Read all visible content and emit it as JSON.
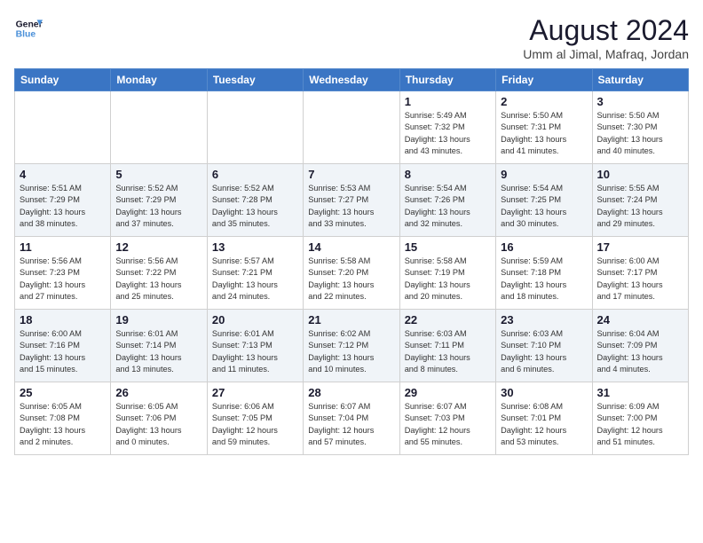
{
  "logo": {
    "line1": "General",
    "line2": "Blue"
  },
  "title": "August 2024",
  "location": "Umm al Jimal, Mafraq, Jordan",
  "weekdays": [
    "Sunday",
    "Monday",
    "Tuesday",
    "Wednesday",
    "Thursday",
    "Friday",
    "Saturday"
  ],
  "weeks": [
    [
      {
        "day": "",
        "info": ""
      },
      {
        "day": "",
        "info": ""
      },
      {
        "day": "",
        "info": ""
      },
      {
        "day": "",
        "info": ""
      },
      {
        "day": "1",
        "info": "Sunrise: 5:49 AM\nSunset: 7:32 PM\nDaylight: 13 hours\nand 43 minutes."
      },
      {
        "day": "2",
        "info": "Sunrise: 5:50 AM\nSunset: 7:31 PM\nDaylight: 13 hours\nand 41 minutes."
      },
      {
        "day": "3",
        "info": "Sunrise: 5:50 AM\nSunset: 7:30 PM\nDaylight: 13 hours\nand 40 minutes."
      }
    ],
    [
      {
        "day": "4",
        "info": "Sunrise: 5:51 AM\nSunset: 7:29 PM\nDaylight: 13 hours\nand 38 minutes."
      },
      {
        "day": "5",
        "info": "Sunrise: 5:52 AM\nSunset: 7:29 PM\nDaylight: 13 hours\nand 37 minutes."
      },
      {
        "day": "6",
        "info": "Sunrise: 5:52 AM\nSunset: 7:28 PM\nDaylight: 13 hours\nand 35 minutes."
      },
      {
        "day": "7",
        "info": "Sunrise: 5:53 AM\nSunset: 7:27 PM\nDaylight: 13 hours\nand 33 minutes."
      },
      {
        "day": "8",
        "info": "Sunrise: 5:54 AM\nSunset: 7:26 PM\nDaylight: 13 hours\nand 32 minutes."
      },
      {
        "day": "9",
        "info": "Sunrise: 5:54 AM\nSunset: 7:25 PM\nDaylight: 13 hours\nand 30 minutes."
      },
      {
        "day": "10",
        "info": "Sunrise: 5:55 AM\nSunset: 7:24 PM\nDaylight: 13 hours\nand 29 minutes."
      }
    ],
    [
      {
        "day": "11",
        "info": "Sunrise: 5:56 AM\nSunset: 7:23 PM\nDaylight: 13 hours\nand 27 minutes."
      },
      {
        "day": "12",
        "info": "Sunrise: 5:56 AM\nSunset: 7:22 PM\nDaylight: 13 hours\nand 25 minutes."
      },
      {
        "day": "13",
        "info": "Sunrise: 5:57 AM\nSunset: 7:21 PM\nDaylight: 13 hours\nand 24 minutes."
      },
      {
        "day": "14",
        "info": "Sunrise: 5:58 AM\nSunset: 7:20 PM\nDaylight: 13 hours\nand 22 minutes."
      },
      {
        "day": "15",
        "info": "Sunrise: 5:58 AM\nSunset: 7:19 PM\nDaylight: 13 hours\nand 20 minutes."
      },
      {
        "day": "16",
        "info": "Sunrise: 5:59 AM\nSunset: 7:18 PM\nDaylight: 13 hours\nand 18 minutes."
      },
      {
        "day": "17",
        "info": "Sunrise: 6:00 AM\nSunset: 7:17 PM\nDaylight: 13 hours\nand 17 minutes."
      }
    ],
    [
      {
        "day": "18",
        "info": "Sunrise: 6:00 AM\nSunset: 7:16 PM\nDaylight: 13 hours\nand 15 minutes."
      },
      {
        "day": "19",
        "info": "Sunrise: 6:01 AM\nSunset: 7:14 PM\nDaylight: 13 hours\nand 13 minutes."
      },
      {
        "day": "20",
        "info": "Sunrise: 6:01 AM\nSunset: 7:13 PM\nDaylight: 13 hours\nand 11 minutes."
      },
      {
        "day": "21",
        "info": "Sunrise: 6:02 AM\nSunset: 7:12 PM\nDaylight: 13 hours\nand 10 minutes."
      },
      {
        "day": "22",
        "info": "Sunrise: 6:03 AM\nSunset: 7:11 PM\nDaylight: 13 hours\nand 8 minutes."
      },
      {
        "day": "23",
        "info": "Sunrise: 6:03 AM\nSunset: 7:10 PM\nDaylight: 13 hours\nand 6 minutes."
      },
      {
        "day": "24",
        "info": "Sunrise: 6:04 AM\nSunset: 7:09 PM\nDaylight: 13 hours\nand 4 minutes."
      }
    ],
    [
      {
        "day": "25",
        "info": "Sunrise: 6:05 AM\nSunset: 7:08 PM\nDaylight: 13 hours\nand 2 minutes."
      },
      {
        "day": "26",
        "info": "Sunrise: 6:05 AM\nSunset: 7:06 PM\nDaylight: 13 hours\nand 0 minutes."
      },
      {
        "day": "27",
        "info": "Sunrise: 6:06 AM\nSunset: 7:05 PM\nDaylight: 12 hours\nand 59 minutes."
      },
      {
        "day": "28",
        "info": "Sunrise: 6:07 AM\nSunset: 7:04 PM\nDaylight: 12 hours\nand 57 minutes."
      },
      {
        "day": "29",
        "info": "Sunrise: 6:07 AM\nSunset: 7:03 PM\nDaylight: 12 hours\nand 55 minutes."
      },
      {
        "day": "30",
        "info": "Sunrise: 6:08 AM\nSunset: 7:01 PM\nDaylight: 12 hours\nand 53 minutes."
      },
      {
        "day": "31",
        "info": "Sunrise: 6:09 AM\nSunset: 7:00 PM\nDaylight: 12 hours\nand 51 minutes."
      }
    ]
  ]
}
